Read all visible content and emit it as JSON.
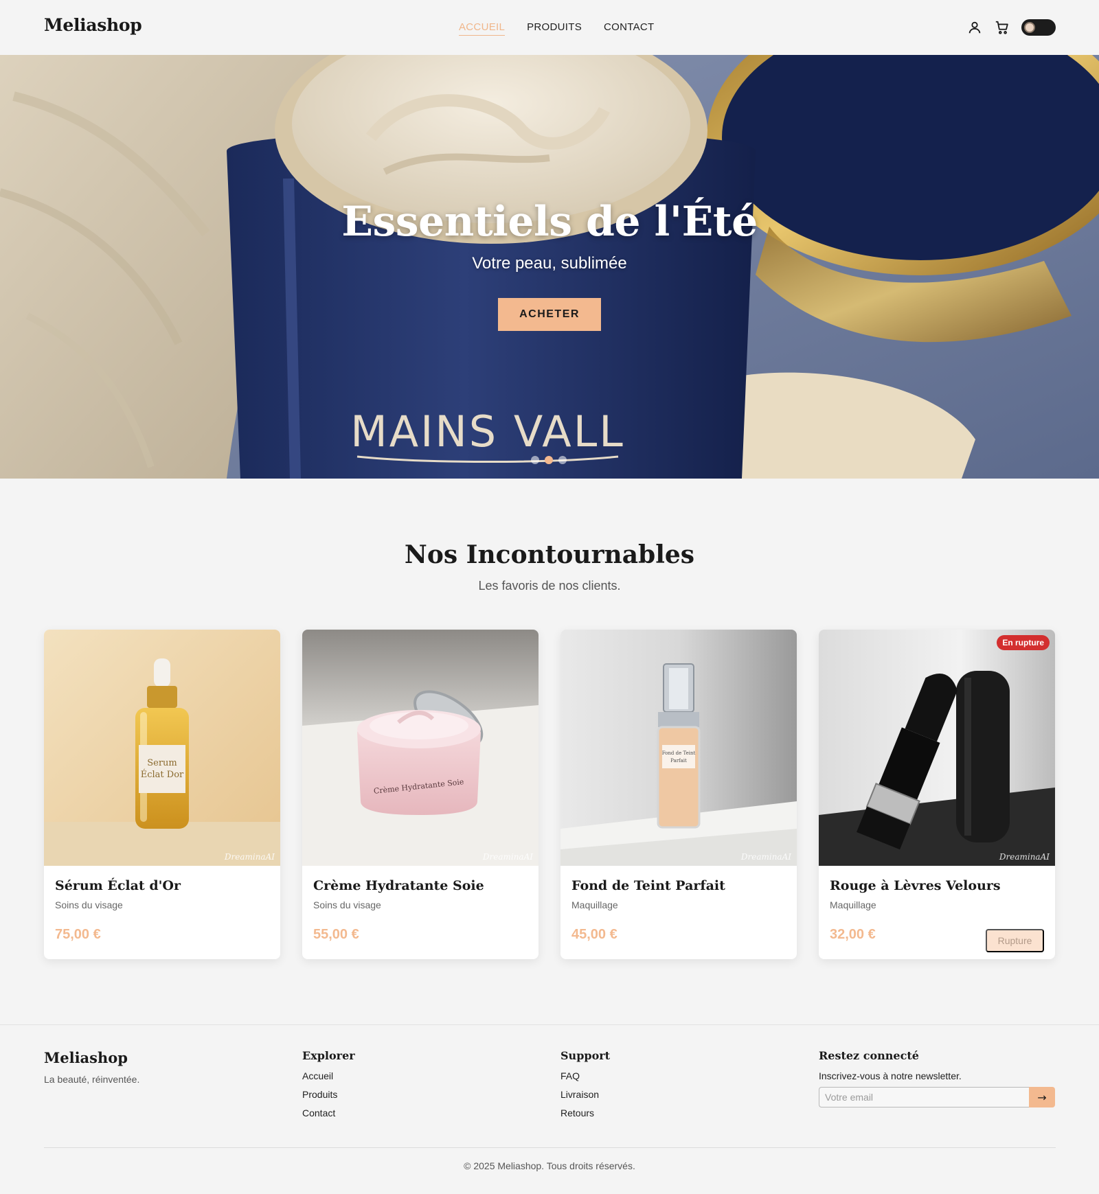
{
  "header": {
    "logo": "Meliashop",
    "nav": [
      {
        "label": "ACCUEIL",
        "active": true
      },
      {
        "label": "PRODUITS",
        "active": false
      },
      {
        "label": "CONTACT",
        "active": false
      }
    ],
    "icons": [
      "user-icon",
      "cart-icon",
      "theme-toggle"
    ]
  },
  "hero": {
    "title": "Essentiels de l'Été",
    "subtitle": "Votre peau, sublimée",
    "cta": "ACHETER",
    "jar_text": "MAINS VALL",
    "slides": 3,
    "active_slide": 2
  },
  "section": {
    "title": "Nos Incontournables",
    "subtitle": "Les favoris de nos clients."
  },
  "products": [
    {
      "name": "Sérum Éclat d'Or",
      "category": "Soins du visage",
      "price": "75,00 €",
      "label_lines": [
        "Serum",
        "Éclat Dor"
      ],
      "out_of_stock": false
    },
    {
      "name": "Crème Hydratante Soie",
      "category": "Soins du visage",
      "price": "55,00 €",
      "label_lines": [
        "Crème Hydratante Soie"
      ],
      "out_of_stock": false
    },
    {
      "name": "Fond de Teint Parfait",
      "category": "Maquillage",
      "price": "45,00 €",
      "label_lines": [
        "Fond de Teint",
        "Parfait"
      ],
      "out_of_stock": false
    },
    {
      "name": "Rouge à Lèvres Velours",
      "category": "Maquillage",
      "price": "32,00 €",
      "label_lines": [],
      "out_of_stock": true,
      "badge": "En rupture",
      "button": "Rupture"
    }
  ],
  "watermark": "DreaminaAI",
  "footer": {
    "logo": "Meliashop",
    "tagline": "La beauté, réinventée.",
    "explorer": {
      "title": "Explorer",
      "links": [
        "Accueil",
        "Produits",
        "Contact"
      ]
    },
    "support": {
      "title": "Support",
      "links": [
        "FAQ",
        "Livraison",
        "Retours"
      ]
    },
    "newsletter": {
      "title": "Restez connecté",
      "text": "Inscrivez-vous à notre newsletter.",
      "placeholder": "Votre email",
      "submit": "→"
    },
    "copyright": "© 2025 Meliashop. Tous droits réservés."
  },
  "colors": {
    "accent": "#f3b98f",
    "badge": "#d32f2f",
    "background": "#f4f4f4"
  }
}
